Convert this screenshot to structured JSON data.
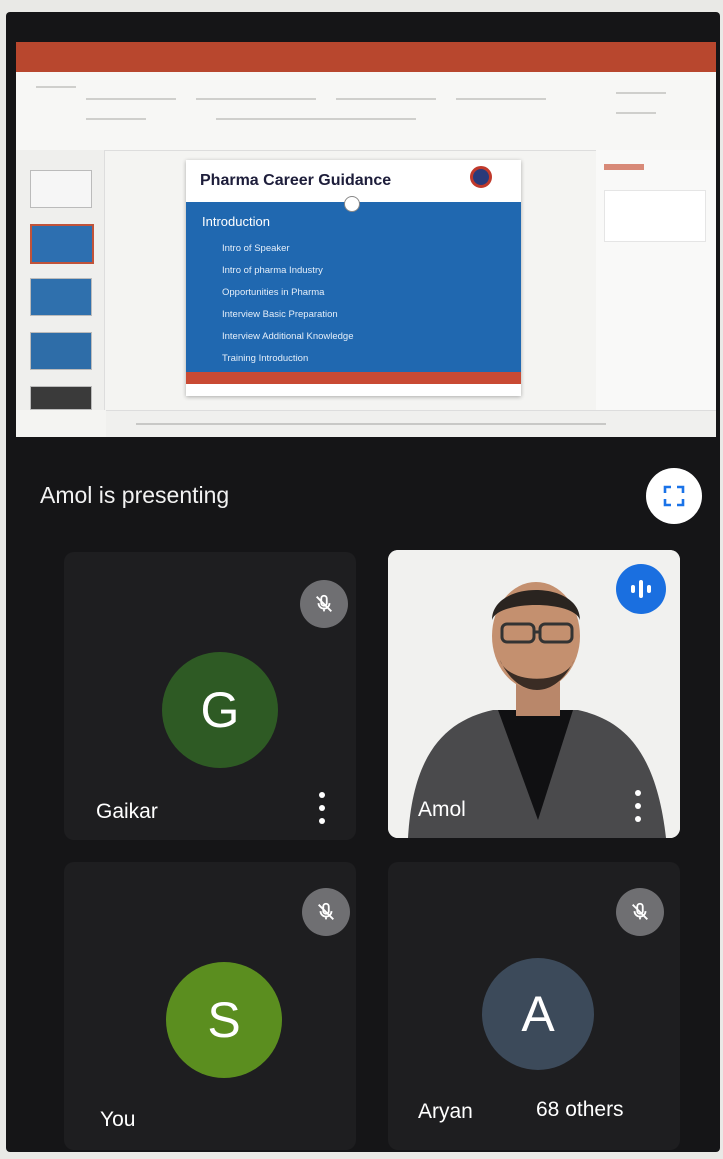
{
  "presentation": {
    "slide_title": "Pharma Career Guidance",
    "slide_heading": "Introduction",
    "slide_items": [
      "Intro of Speaker",
      "Intro of pharma Industry",
      "Opportunities in Pharma",
      "Interview Basic Preparation",
      "Interview Additional Knowledge",
      "Training Introduction"
    ]
  },
  "presenting": {
    "label": "Amol is presenting"
  },
  "participants": [
    {
      "name": "Gaikar",
      "initial": "G",
      "avatar_color": "#2e5a24",
      "muted": true
    },
    {
      "name": "Amol",
      "video": true,
      "speaking": true
    },
    {
      "name": "You",
      "initial": "S",
      "avatar_color": "#5b8e1f",
      "muted": true
    },
    {
      "name": "Aryan",
      "initial": "A",
      "avatar_color": "#3c4a5a",
      "muted": true,
      "others_label": "68 others"
    }
  ],
  "colors": {
    "speaking_blue": "#1a6fe0",
    "slide_blue": "#2068b0",
    "slide_red": "#c94a34"
  },
  "icons": {
    "fullscreen": "fullscreen-icon",
    "muted": "mic-off-icon",
    "speaking": "audio-level-icon",
    "more": "more-vert-icon"
  }
}
